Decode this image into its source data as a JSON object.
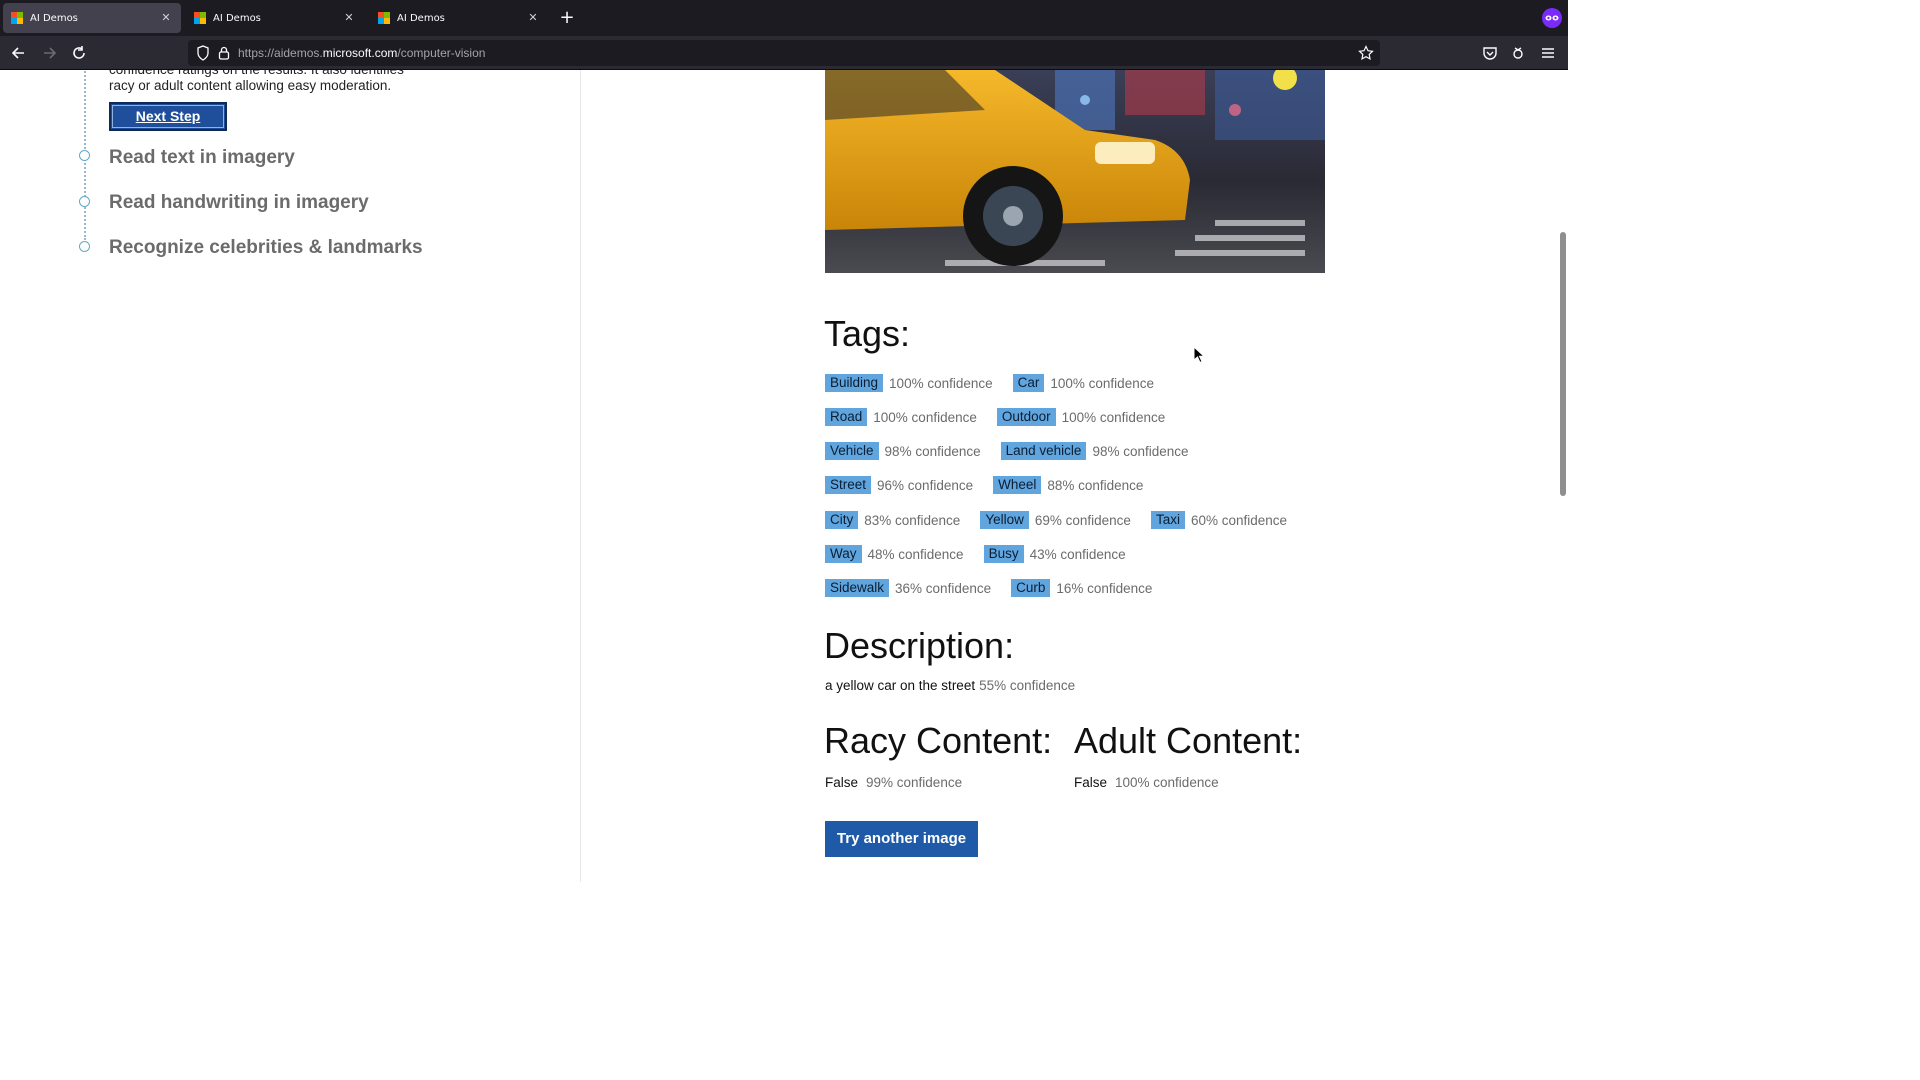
{
  "browser": {
    "tabs": [
      {
        "label": "AI Demos",
        "active": true
      },
      {
        "label": "AI Demos",
        "active": false
      },
      {
        "label": "AI Demos",
        "active": false
      }
    ],
    "url_prefix": "https://aidemos.",
    "url_host": "microsoft.com",
    "url_path": "/computer-vision",
    "icons": [
      "back-icon",
      "forward-icon",
      "reload-icon",
      "shield-icon",
      "lock-icon",
      "star-icon",
      "pocket-icon",
      "extension-icon",
      "menu-icon",
      "close-icon",
      "plus-icon"
    ]
  },
  "sidebar": {
    "intro_line1": "confidence ratings on the results. It also identifies",
    "intro_line2": "racy or adult content allowing easy moderation.",
    "next_step_label": "Next Step",
    "steps": [
      {
        "label": "Read text in imagery"
      },
      {
        "label": "Read handwriting in imagery"
      },
      {
        "label": "Recognize celebrities & landmarks"
      }
    ]
  },
  "results": {
    "tags_heading": "Tags:",
    "tag_rows": [
      [
        {
          "tag": "Building",
          "conf": "100% confidence"
        },
        {
          "tag": "Car",
          "conf": "100% confidence"
        }
      ],
      [
        {
          "tag": "Road",
          "conf": "100% confidence"
        },
        {
          "tag": "Outdoor",
          "conf": "100% confidence"
        }
      ],
      [
        {
          "tag": "Vehicle",
          "conf": "98% confidence"
        },
        {
          "tag": "Land vehicle",
          "conf": "98% confidence"
        }
      ],
      [
        {
          "tag": "Street",
          "conf": "96% confidence"
        },
        {
          "tag": "Wheel",
          "conf": "88% confidence"
        }
      ],
      [
        {
          "tag": "City",
          "conf": "83% confidence"
        },
        {
          "tag": "Yellow",
          "conf": "69% confidence"
        },
        {
          "tag": "Taxi",
          "conf": "60% confidence"
        }
      ],
      [
        {
          "tag": "Way",
          "conf": "48% confidence"
        },
        {
          "tag": "Busy",
          "conf": "43% confidence"
        }
      ],
      [
        {
          "tag": "Sidewalk",
          "conf": "36% confidence"
        },
        {
          "tag": "Curb",
          "conf": "16% confidence"
        }
      ]
    ],
    "description_heading": "Description:",
    "description_text": "a yellow car on the street",
    "description_conf": "55% confidence",
    "racy_heading": "Racy Content:",
    "racy_value": "False",
    "racy_conf": "99% confidence",
    "adult_heading": "Adult Content:",
    "adult_value": "False",
    "adult_conf": "100% confidence",
    "try_button_label": "Try another image"
  },
  "colors": {
    "tag_bg": "#60a5de",
    "button_bg": "#1f5aa8",
    "chrome_bg": "#1c1b22",
    "step_dot": "#62a9c9"
  }
}
